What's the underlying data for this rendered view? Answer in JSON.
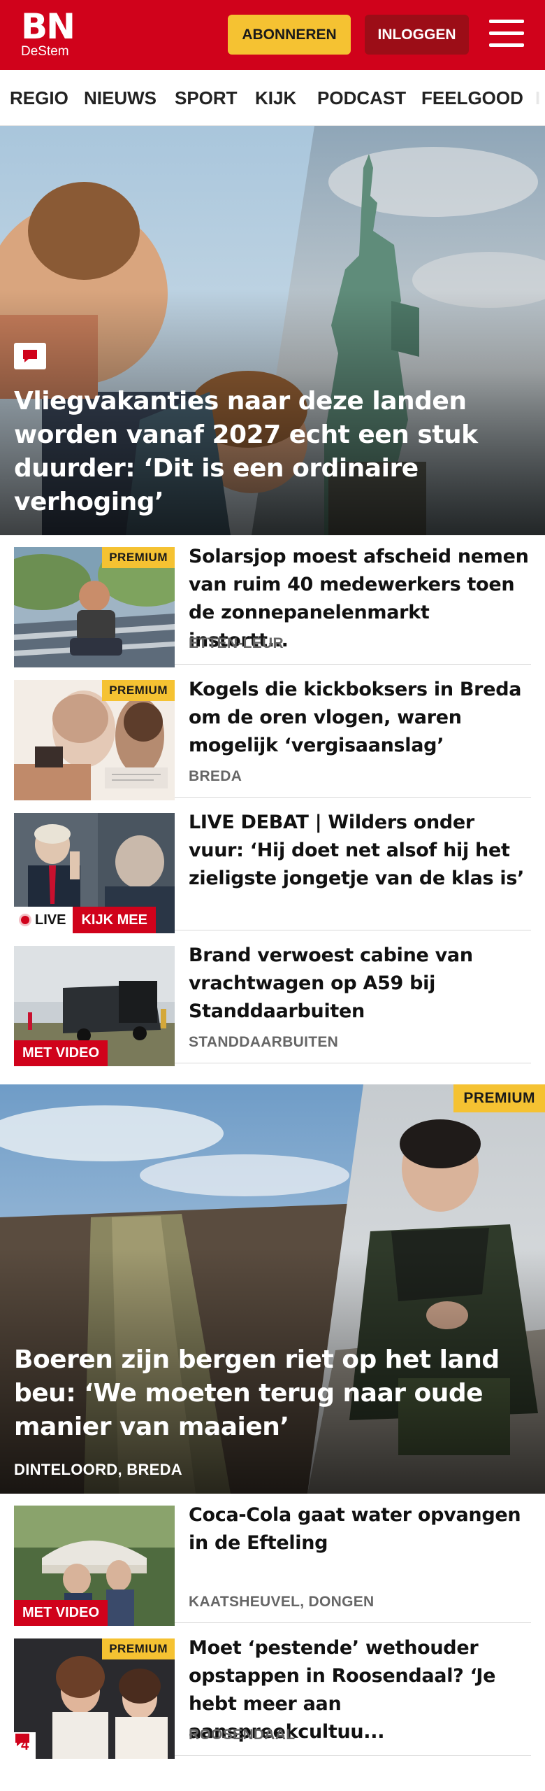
{
  "header": {
    "logo_main": "BN",
    "logo_sub": "DeStem",
    "subscribe_label": "ABONNEREN",
    "login_label": "INLOGGEN"
  },
  "nav": {
    "items": [
      "REGIO",
      "NIEUWS",
      "SPORT",
      "KIJK",
      "PODCAST",
      "FEELGOOD"
    ]
  },
  "hero": {
    "title": "Vliegvakanties naar deze landen worden vanaf 2027 echt een stuk duurder: ‘Dit is een ordinaire verhoging’",
    "badge_icon": "comment-icon"
  },
  "articles": [
    {
      "title": "Solarsjop moest afscheid nemen van ruim 40 medewerkers toen de zonnepanelenmarkt instortt...",
      "meta": "ETTEN-LEUR",
      "tag": "PREMIUM"
    },
    {
      "title": "Kogels die kickboksers in Breda om de oren vlogen, waren mogelijk ‘vergisaanslag’",
      "meta": "BREDA",
      "tag": "PREMIUM"
    },
    {
      "title": "LIVE DEBAT | Wilders onder vuur: ‘Hij doet net alsof hij het zieligste jongetje van de klas is’",
      "live_label": "LIVE",
      "watch_label": "KIJK MEE"
    },
    {
      "title": "Brand verwoest cabine van vrachtwagen op A59 bij Standdaarbuiten",
      "meta": "STANDDAARBUITEN",
      "video_label": "MET VIDEO"
    }
  ],
  "feature": {
    "title": "Boeren zijn bergen riet op het land beu: ‘We moeten terug naar oude manier van maaien’",
    "meta": "DINTELOORD, BREDA",
    "tag": "PREMIUM"
  },
  "articles2": [
    {
      "title": "Coca-Cola gaat water opvangen in de Efteling",
      "meta": "KAATSHEUVEL, DONGEN",
      "video_label": "MET VIDEO"
    },
    {
      "title": "Moet ‘pestende’ wethouder opstappen in Roosendaal? ‘Je hebt meer aan aanspreekcultuu...",
      "meta": "ROOSENDAAL",
      "tag": "PREMIUM",
      "comments": "4"
    }
  ],
  "colors": {
    "brand_red": "#d0021b",
    "premium_yellow": "#f5c232",
    "login_dark_red": "#9c0d17"
  }
}
